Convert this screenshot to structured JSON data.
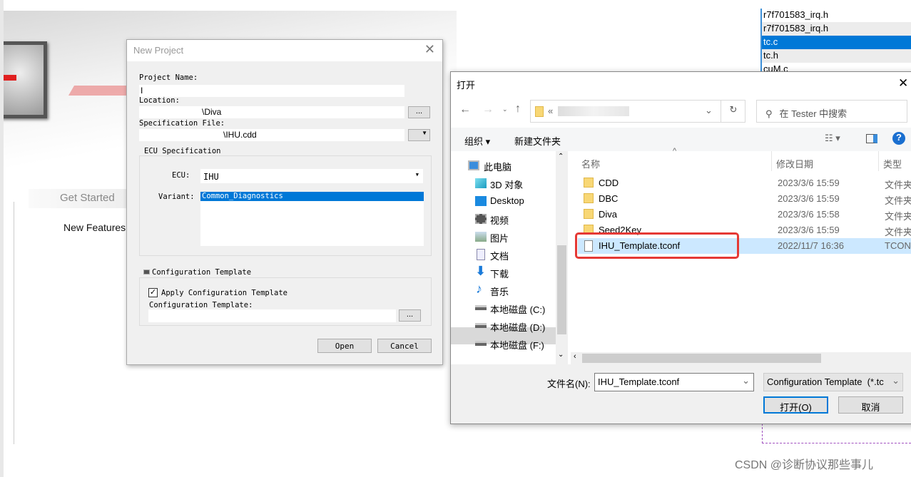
{
  "background": {
    "tab_get_started": "Get Started",
    "link_new_features": "New Features",
    "file_list": [
      {
        "name": "r7f701583_irq.h",
        "selected": false
      },
      {
        "name": "r7f701583_irq.h",
        "selected": false
      },
      {
        "name": "tc.c",
        "selected": true
      },
      {
        "name": "tc.h",
        "selected": false
      },
      {
        "name": "cuM.c",
        "selected": false
      }
    ],
    "watermark": "CSDN @诊断协议那些事儿"
  },
  "new_project": {
    "title": "New Project",
    "project_name_label": "Project Name:",
    "project_name_value": "I",
    "location_label": "Location:",
    "location_value": "\\Diva",
    "browse": "...",
    "spec_file_label": "Specification File:",
    "spec_file_value": "\\IHU.cdd",
    "ecu_group": "ECU Specification",
    "ecu_label": "ECU:",
    "ecu_value": "IHU",
    "variant_label": "Variant:",
    "variants": [
      "Common_Diagnostics"
    ],
    "config_group": "Configuration Template",
    "apply_label": "Apply Configuration Template",
    "apply_checked": true,
    "config_template_label": "Configuration Template:",
    "config_template_value": "",
    "open": "Open",
    "cancel": "Cancel"
  },
  "open_dialog": {
    "title": "打开",
    "address_prefix": "«",
    "search_placeholder": "在 Tester 中搜索",
    "organize": "组织 ▾",
    "new_folder": "新建文件夹",
    "nav": [
      "此电脑",
      "3D 对象",
      "Desktop",
      "视频",
      "图片",
      "文档",
      "下载",
      "音乐",
      "本地磁盘 (C:)",
      "本地磁盘 (D:)",
      "本地磁盘 (F:)"
    ],
    "nav_selected": "本地磁盘 (F:)",
    "columns": {
      "name": "名称",
      "date": "修改日期",
      "type": "类型"
    },
    "files": [
      {
        "name": "CDD",
        "date": "2023/3/6 15:59",
        "type": "文件夹",
        "folder": true
      },
      {
        "name": "DBC",
        "date": "2023/3/6 15:59",
        "type": "文件夹",
        "folder": true
      },
      {
        "name": "Diva",
        "date": "2023/3/6 15:58",
        "type": "文件夹",
        "folder": true
      },
      {
        "name": "Seed2Key",
        "date": "2023/3/6 15:59",
        "type": "文件夹",
        "folder": true
      },
      {
        "name": "IHU_Template.tconf",
        "date": "2022/11/7 16:36",
        "type": "TCONF",
        "folder": false,
        "selected": true
      }
    ],
    "filename_label": "文件名(N):",
    "filename_value": "IHU_Template.tconf",
    "filter": "Configuration Template  (*.tc",
    "open_btn": "打开(O)",
    "cancel_btn": "取消",
    "highlight_color": "#e53935"
  }
}
